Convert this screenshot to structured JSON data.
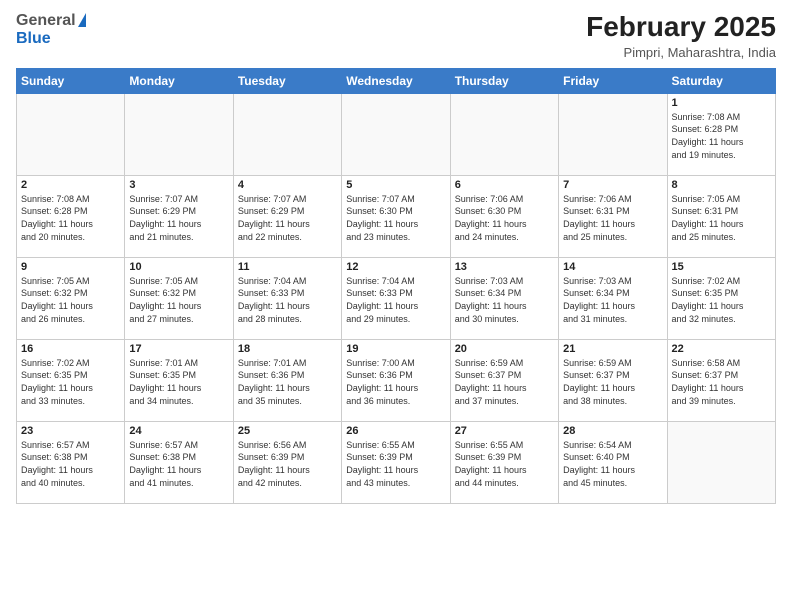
{
  "header": {
    "logo_general": "General",
    "logo_blue": "Blue",
    "month_title": "February 2025",
    "location": "Pimpri, Maharashtra, India"
  },
  "weekdays": [
    "Sunday",
    "Monday",
    "Tuesday",
    "Wednesday",
    "Thursday",
    "Friday",
    "Saturday"
  ],
  "weeks": [
    [
      {
        "day": "",
        "info": ""
      },
      {
        "day": "",
        "info": ""
      },
      {
        "day": "",
        "info": ""
      },
      {
        "day": "",
        "info": ""
      },
      {
        "day": "",
        "info": ""
      },
      {
        "day": "",
        "info": ""
      },
      {
        "day": "1",
        "info": "Sunrise: 7:08 AM\nSunset: 6:28 PM\nDaylight: 11 hours\nand 19 minutes."
      }
    ],
    [
      {
        "day": "2",
        "info": "Sunrise: 7:08 AM\nSunset: 6:28 PM\nDaylight: 11 hours\nand 20 minutes."
      },
      {
        "day": "3",
        "info": "Sunrise: 7:07 AM\nSunset: 6:29 PM\nDaylight: 11 hours\nand 21 minutes."
      },
      {
        "day": "4",
        "info": "Sunrise: 7:07 AM\nSunset: 6:29 PM\nDaylight: 11 hours\nand 22 minutes."
      },
      {
        "day": "5",
        "info": "Sunrise: 7:07 AM\nSunset: 6:30 PM\nDaylight: 11 hours\nand 23 minutes."
      },
      {
        "day": "6",
        "info": "Sunrise: 7:06 AM\nSunset: 6:30 PM\nDaylight: 11 hours\nand 24 minutes."
      },
      {
        "day": "7",
        "info": "Sunrise: 7:06 AM\nSunset: 6:31 PM\nDaylight: 11 hours\nand 25 minutes."
      },
      {
        "day": "8",
        "info": "Sunrise: 7:05 AM\nSunset: 6:31 PM\nDaylight: 11 hours\nand 25 minutes."
      }
    ],
    [
      {
        "day": "9",
        "info": "Sunrise: 7:05 AM\nSunset: 6:32 PM\nDaylight: 11 hours\nand 26 minutes."
      },
      {
        "day": "10",
        "info": "Sunrise: 7:05 AM\nSunset: 6:32 PM\nDaylight: 11 hours\nand 27 minutes."
      },
      {
        "day": "11",
        "info": "Sunrise: 7:04 AM\nSunset: 6:33 PM\nDaylight: 11 hours\nand 28 minutes."
      },
      {
        "day": "12",
        "info": "Sunrise: 7:04 AM\nSunset: 6:33 PM\nDaylight: 11 hours\nand 29 minutes."
      },
      {
        "day": "13",
        "info": "Sunrise: 7:03 AM\nSunset: 6:34 PM\nDaylight: 11 hours\nand 30 minutes."
      },
      {
        "day": "14",
        "info": "Sunrise: 7:03 AM\nSunset: 6:34 PM\nDaylight: 11 hours\nand 31 minutes."
      },
      {
        "day": "15",
        "info": "Sunrise: 7:02 AM\nSunset: 6:35 PM\nDaylight: 11 hours\nand 32 minutes."
      }
    ],
    [
      {
        "day": "16",
        "info": "Sunrise: 7:02 AM\nSunset: 6:35 PM\nDaylight: 11 hours\nand 33 minutes."
      },
      {
        "day": "17",
        "info": "Sunrise: 7:01 AM\nSunset: 6:35 PM\nDaylight: 11 hours\nand 34 minutes."
      },
      {
        "day": "18",
        "info": "Sunrise: 7:01 AM\nSunset: 6:36 PM\nDaylight: 11 hours\nand 35 minutes."
      },
      {
        "day": "19",
        "info": "Sunrise: 7:00 AM\nSunset: 6:36 PM\nDaylight: 11 hours\nand 36 minutes."
      },
      {
        "day": "20",
        "info": "Sunrise: 6:59 AM\nSunset: 6:37 PM\nDaylight: 11 hours\nand 37 minutes."
      },
      {
        "day": "21",
        "info": "Sunrise: 6:59 AM\nSunset: 6:37 PM\nDaylight: 11 hours\nand 38 minutes."
      },
      {
        "day": "22",
        "info": "Sunrise: 6:58 AM\nSunset: 6:37 PM\nDaylight: 11 hours\nand 39 minutes."
      }
    ],
    [
      {
        "day": "23",
        "info": "Sunrise: 6:57 AM\nSunset: 6:38 PM\nDaylight: 11 hours\nand 40 minutes."
      },
      {
        "day": "24",
        "info": "Sunrise: 6:57 AM\nSunset: 6:38 PM\nDaylight: 11 hours\nand 41 minutes."
      },
      {
        "day": "25",
        "info": "Sunrise: 6:56 AM\nSunset: 6:39 PM\nDaylight: 11 hours\nand 42 minutes."
      },
      {
        "day": "26",
        "info": "Sunrise: 6:55 AM\nSunset: 6:39 PM\nDaylight: 11 hours\nand 43 minutes."
      },
      {
        "day": "27",
        "info": "Sunrise: 6:55 AM\nSunset: 6:39 PM\nDaylight: 11 hours\nand 44 minutes."
      },
      {
        "day": "28",
        "info": "Sunrise: 6:54 AM\nSunset: 6:40 PM\nDaylight: 11 hours\nand 45 minutes."
      },
      {
        "day": "",
        "info": ""
      }
    ]
  ]
}
